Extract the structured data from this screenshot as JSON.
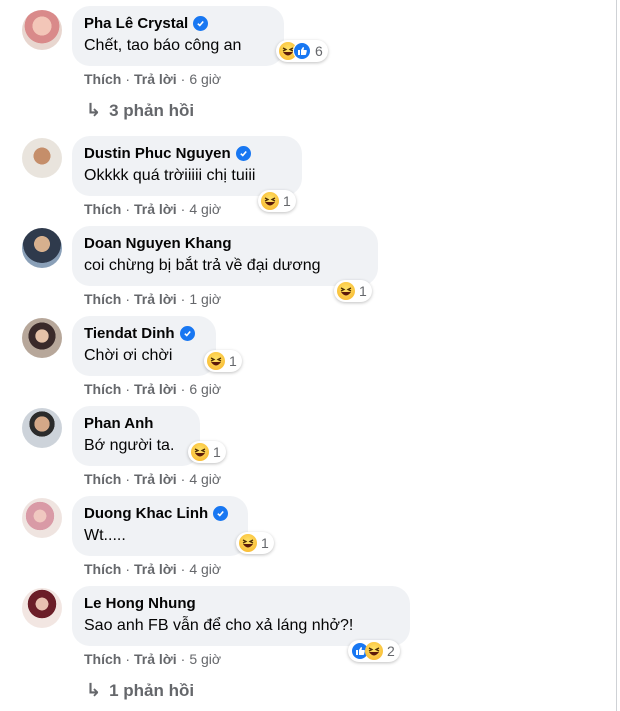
{
  "comments": [
    {
      "author": "Pha Lê Crystal",
      "verified": true,
      "text": "Chết, tao báo công an",
      "reactions": [
        "haha-icon",
        "like-icon"
      ],
      "reaction_count": "6",
      "like": "Thích",
      "reply": "Trả lời",
      "time": "6 giờ",
      "replies": "3 phản hồi"
    },
    {
      "author": "Dustin Phuc Nguyen",
      "verified": true,
      "text": "Okkkk quá trờiiiii chị tuiii",
      "reactions": [
        "haha-icon"
      ],
      "reaction_count": "1",
      "like": "Thích",
      "reply": "Trả lời",
      "time": "4 giờ"
    },
    {
      "author": "Doan Nguyen Khang",
      "verified": false,
      "text": "coi chừng bị bắt trả về đại dương",
      "reactions": [
        "haha-icon"
      ],
      "reaction_count": "1",
      "like": "Thích",
      "reply": "Trả lời",
      "time": "1 giờ"
    },
    {
      "author": "Tiendat Dinh",
      "verified": true,
      "text": "Chời ơi chời",
      "reactions": [
        "haha-icon"
      ],
      "reaction_count": "1",
      "like": "Thích",
      "reply": "Trả lời",
      "time": "6 giờ"
    },
    {
      "author": "Phan Anh",
      "verified": false,
      "text": "Bớ người ta.",
      "reactions": [
        "haha-icon"
      ],
      "reaction_count": "1",
      "like": "Thích",
      "reply": "Trả lời",
      "time": "4 giờ"
    },
    {
      "author": "Duong Khac Linh",
      "verified": true,
      "text": "Wt.....",
      "reactions": [
        "haha-icon"
      ],
      "reaction_count": "1",
      "like": "Thích",
      "reply": "Trả lời",
      "time": "4 giờ"
    },
    {
      "author": "Le Hong Nhung",
      "verified": false,
      "text": "Sao anh FB vẫn để cho xả láng nhở?!",
      "reactions": [
        "like-icon",
        "haha-icon"
      ],
      "reaction_count": "2",
      "like": "Thích",
      "reply": "Trả lời",
      "time": "5 giờ",
      "replies": "1 phản hồi"
    }
  ],
  "colors": {
    "bubble": "#f0f2f5",
    "secondary_text": "#65676b",
    "verified_blue": "#1877f2",
    "haha_yellow": "#f7b125"
  }
}
